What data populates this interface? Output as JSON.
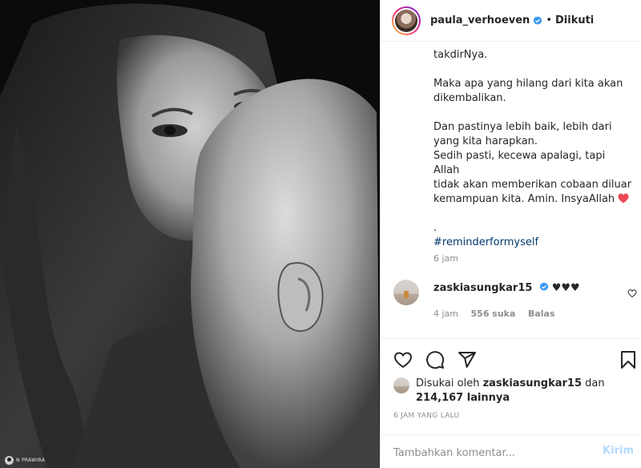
{
  "post": {
    "username": "paula_verhoeven",
    "follow_status": "Diikuti",
    "caption_lines": [
      "takdirNya.",
      "",
      "Maka apa yang hilang dari kita akan",
      "dikembalikan.",
      "",
      "Dan pastinya lebih baik, lebih dari",
      "yang kita harapkan.",
      "Sedih pasti, kecewa apalagi, tapi Allah",
      "tidak akan memberikan cobaan diluar",
      "kemampuan kita. Amin. InsyaAllah"
    ],
    "caption_dot": ".",
    "hashtag": "#reminderformyself",
    "caption_time": "6 jam",
    "watermark": "N PRAWIRA"
  },
  "comment": {
    "username": "zaskiasungkar15",
    "text": "♥♥♥",
    "time": "4 jam",
    "likes": "556 suka",
    "reply": "Balas"
  },
  "likes": {
    "prefix": "Disukai oleh",
    "user": "zaskiasungkar15",
    "and": "dan",
    "count": "214,167 lainnya"
  },
  "post_time": "6 JAM YANG LALU",
  "add_comment": {
    "placeholder": "Tambahkan komentar...",
    "post_label": "Kirim"
  },
  "icons": {
    "verified": "verified-icon",
    "like": "heart-icon",
    "comment": "comment-icon",
    "share": "share-icon",
    "save": "bookmark-icon"
  },
  "colors": {
    "verified": "#3897f0",
    "hashtag": "#00376b",
    "heart_emoji": "#ed4956",
    "post_button": "#b3dbff",
    "muted": "#8e8e8e"
  }
}
